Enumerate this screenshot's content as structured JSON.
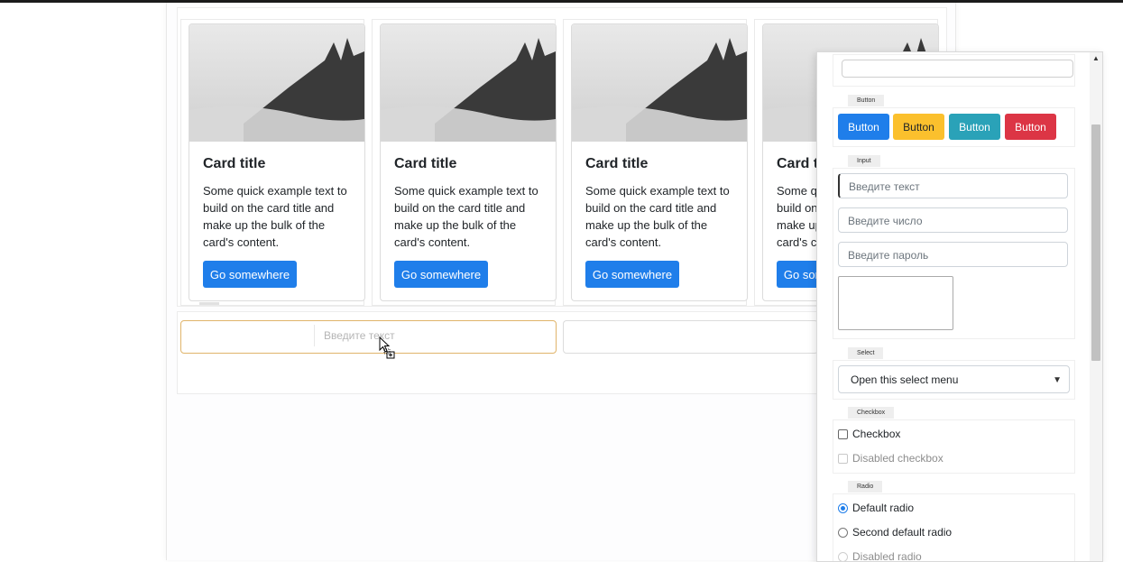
{
  "cards": [
    {
      "title": "Card title",
      "text": "Some quick example text to build on the card title and make up the bulk of the card's content.",
      "button": "Go somewhere"
    },
    {
      "title": "Card title",
      "text": "Some quick example text to build on the card title and make up the bulk of the card's content.",
      "button": "Go somewhere"
    },
    {
      "title": "Card title",
      "text": "Some quick example text to build on the card title and make up the bulk of the card's content.",
      "button": "Go somewhere"
    },
    {
      "title": "Card title",
      "text": "Some quick example text to build on the card title and make up the bulk of the card's content.",
      "button": "Go somewhere"
    }
  ],
  "dragged_input": {
    "placeholder": "Введите текст"
  },
  "panel": {
    "button_section": {
      "label": "Button",
      "buttons": [
        {
          "label": "Button",
          "color": "#1f7eea"
        },
        {
          "label": "Button",
          "color": "#fbc02d"
        },
        {
          "label": "Button",
          "color": "#2aa2b8"
        },
        {
          "label": "Button",
          "color": "#dc3545"
        }
      ]
    },
    "input_section": {
      "label": "Input",
      "text_placeholder": "Введите текст",
      "number_placeholder": "Введите число",
      "password_placeholder": "Введите пароль"
    },
    "select_section": {
      "label": "Select",
      "selected": "Open this select menu"
    },
    "checkbox_section": {
      "label": "Checkbox",
      "items": [
        "Checkbox",
        "Disabled checkbox"
      ]
    },
    "radio_section": {
      "label": "Radio",
      "items": [
        "Default radio",
        "Second default radio",
        "Disabled radio"
      ]
    }
  }
}
